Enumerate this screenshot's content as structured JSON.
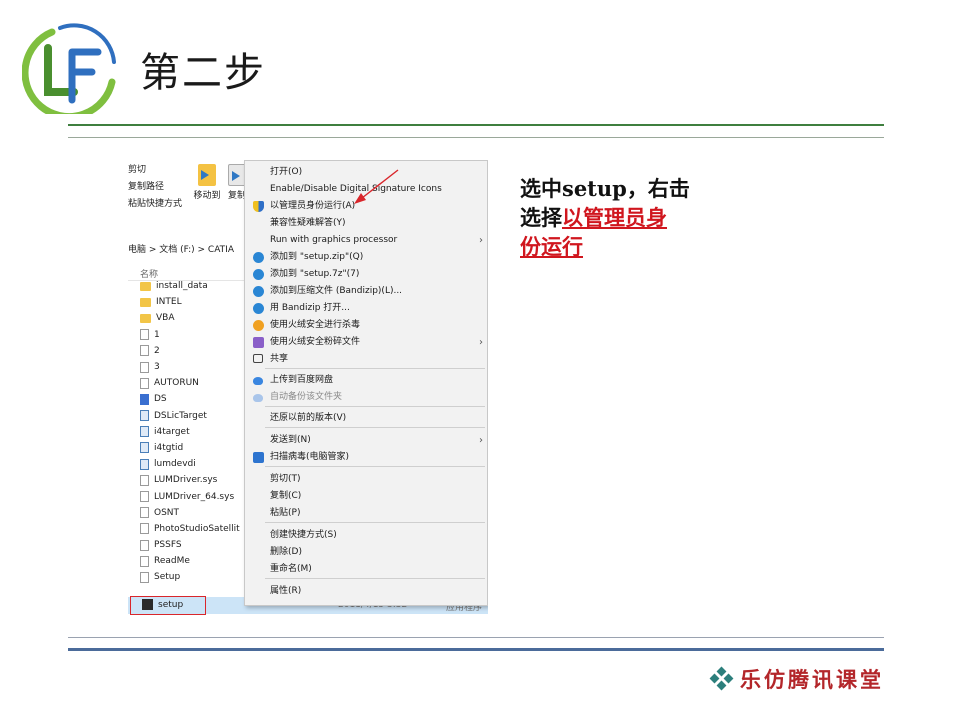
{
  "slide": {
    "title": "第二步",
    "logo_letters": "LF",
    "footer_brand": "乐仿腾讯课堂"
  },
  "instruction": {
    "line1": "选中setup，右击",
    "line2_prefix": "选择",
    "highlight_1": "以管理员身",
    "highlight_2": "份运行"
  },
  "explorer": {
    "clipboard_items": [
      "剪切",
      "复制路径",
      "粘贴快捷方式"
    ],
    "move_to_label": "移动到",
    "copy_to_label": "复制",
    "breadcrumb": "电脑  >  文档 (F:)  >  CATIA",
    "column_name": "名称",
    "files": [
      {
        "name": "install_data",
        "icon": "folder-icon"
      },
      {
        "name": "INTEL",
        "icon": "folder-icon"
      },
      {
        "name": "VBA",
        "icon": "folder-icon"
      },
      {
        "name": "1",
        "icon": "file-icon"
      },
      {
        "name": "2",
        "icon": "file-icon"
      },
      {
        "name": "3",
        "icon": "file-icon"
      },
      {
        "name": "AUTORUN",
        "icon": "file-icon"
      },
      {
        "name": "DS",
        "icon": "ds-icon"
      },
      {
        "name": "DSLicTarget",
        "icon": "app-icon"
      },
      {
        "name": "i4target",
        "icon": "app-icon"
      },
      {
        "name": "i4tgtid",
        "icon": "app-icon"
      },
      {
        "name": "lumdevdi",
        "icon": "app-icon"
      },
      {
        "name": "LUMDriver.sys",
        "icon": "file-icon"
      },
      {
        "name": "LUMDriver_64.sys",
        "icon": "file-icon"
      },
      {
        "name": "OSNT",
        "icon": "file-icon"
      },
      {
        "name": "PhotoStudioSatellit",
        "icon": "file-icon"
      },
      {
        "name": "PSSFS",
        "icon": "file-icon"
      },
      {
        "name": "ReadMe",
        "icon": "file-icon"
      },
      {
        "name": "Setup",
        "icon": "file-icon"
      }
    ],
    "selected_file": {
      "name": "setup",
      "date": "2011/4/15 3:32",
      "type": "应用程序"
    }
  },
  "context_menu": {
    "items": [
      {
        "label": "打开(O)",
        "icon": ""
      },
      {
        "label": "Enable/Disable Digital Signature Icons",
        "icon": ""
      },
      {
        "label": "以管理员身份运行(A)",
        "icon": "shield-icon"
      },
      {
        "label": "兼容性疑难解答(Y)",
        "icon": ""
      },
      {
        "label": "Run with graphics processor",
        "icon": "",
        "submenu": true
      },
      {
        "label": "添加到 \"setup.zip\"(Q)",
        "icon": "bandizip-icon"
      },
      {
        "label": "添加到 \"setup.7z\"(7)",
        "icon": "bandizip-icon"
      },
      {
        "label": "添加到压缩文件 (Bandizip)(L)...",
        "icon": "bandizip-icon"
      },
      {
        "label": "用 Bandizip 打开...",
        "icon": "bandizip-icon"
      },
      {
        "label": "使用火绒安全进行杀毒",
        "icon": "huorong-icon"
      },
      {
        "label": "使用火绒安全粉碎文件",
        "icon": "shredder-icon",
        "submenu": true
      },
      {
        "label": "共享",
        "icon": "share-icon"
      },
      {
        "label": "上传到百度网盘",
        "icon": "baidu-cloud-icon"
      },
      {
        "label": "自动备份该文件夹",
        "icon": "baidu-cloud-icon",
        "disabled": true
      },
      {
        "label": "还原以前的版本(V)",
        "icon": ""
      },
      {
        "label": "发送到(N)",
        "icon": "",
        "submenu": true
      },
      {
        "label": "扫描病毒(电脑管家)",
        "icon": "pc-manager-icon"
      },
      {
        "label": "剪切(T)",
        "icon": ""
      },
      {
        "label": "复制(C)",
        "icon": ""
      },
      {
        "label": "粘贴(P)",
        "icon": ""
      },
      {
        "label": "创建快捷方式(S)",
        "icon": ""
      },
      {
        "label": "删除(D)",
        "icon": ""
      },
      {
        "label": "重命名(M)",
        "icon": ""
      },
      {
        "label": "属性(R)",
        "icon": ""
      }
    ]
  },
  "colors": {
    "highlight_red": "#d0161e",
    "brand_red": "#b3262a",
    "rule_green": "#3f7f3f",
    "rule_blue": "#4b6b9a",
    "selection_blue": "#cce4f7"
  }
}
